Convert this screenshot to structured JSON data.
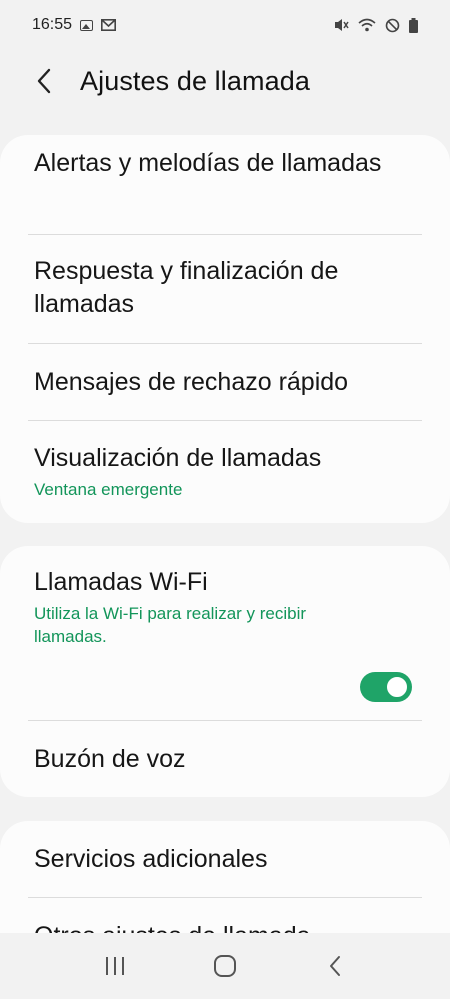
{
  "status_bar": {
    "time": "16:55",
    "left_icons": [
      "gallery-icon",
      "gmail-icon"
    ],
    "right_icons": [
      "mute-icon",
      "wifi-call-icon",
      "do-not-disturb-icon",
      "battery-icon"
    ]
  },
  "header": {
    "title": "Ajustes de llamada",
    "back_icon": "back-arrow-icon"
  },
  "group1": {
    "items": [
      {
        "title": "Alertas y melodías de llamadas"
      },
      {
        "title": "Respuesta y finalización de llamadas"
      },
      {
        "title": "Mensajes de rechazo rápido"
      },
      {
        "title": "Visualización de llamadas",
        "subtitle": "Ventana emergente"
      }
    ]
  },
  "group2": {
    "items": [
      {
        "title": "Llamadas Wi-Fi",
        "subtitle": "Utiliza la Wi-Fi para realizar y recibir llamadas.",
        "toggle_on": true
      },
      {
        "title": "Buzón de voz"
      }
    ]
  },
  "group3": {
    "items": [
      {
        "title": "Servicios adicionales"
      },
      {
        "title": "Otros ajustes de llamada"
      }
    ]
  },
  "nav_bar": {
    "buttons": [
      "recent-apps-icon",
      "home-icon",
      "back-icon"
    ]
  },
  "colors": {
    "accent": "#1fa468",
    "subtitle": "#13955a",
    "background": "#f2f2f2",
    "card": "#fcfcfc"
  }
}
